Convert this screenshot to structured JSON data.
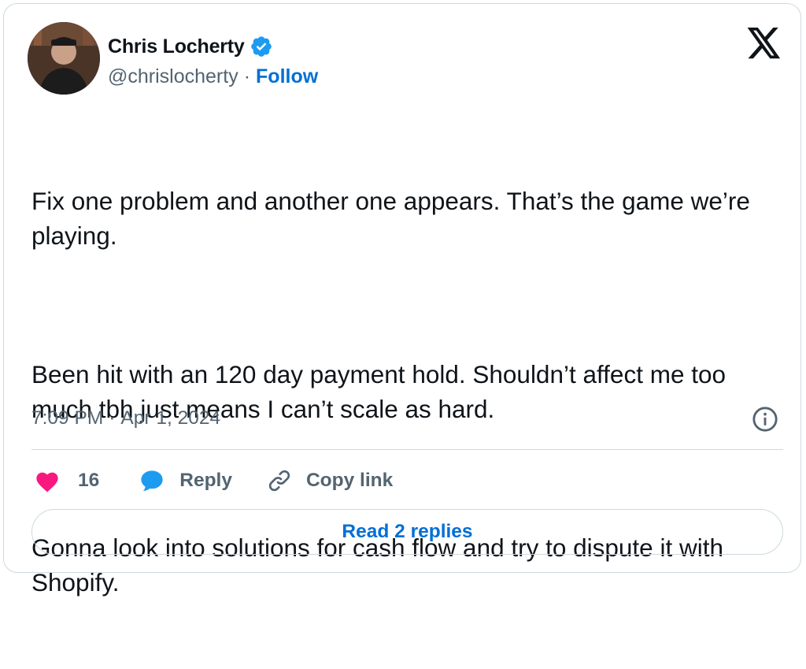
{
  "author": {
    "name": "Chris Locherty",
    "handle": "@chrislocherty",
    "separator": "·",
    "follow_label": "Follow",
    "verified_color": "#1d9bf0"
  },
  "tweet": {
    "paragraphs": [
      "Fix one problem and another one appears. That’s the game we’re playing.",
      "Been hit with an 120 day payment hold. Shouldn’t affect me too much tbh just means I can’t scale as hard.",
      "Gonna look into solutions for cash flow and try to dispute it with Shopify."
    ],
    "time": "7:09 PM",
    "date_separator": "·",
    "date": "Apr 1, 2024"
  },
  "actions": {
    "like_count": "16",
    "reply_label": "Reply",
    "copy_link_label": "Copy link",
    "like_icon": "heart-icon",
    "reply_icon": "speech-bubble-icon",
    "copy_icon": "link-icon"
  },
  "footer": {
    "read_replies_label": "Read 2 replies"
  },
  "colors": {
    "accent": "#006fd6",
    "like": "#f91880",
    "reply": "#1d9bf0",
    "text": "#0f1419",
    "muted": "#536471"
  }
}
